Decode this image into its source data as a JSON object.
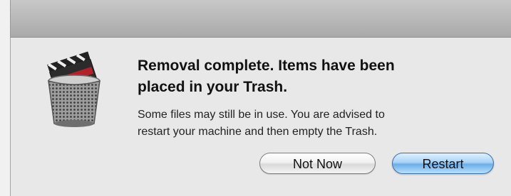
{
  "dialog": {
    "icon": "trash-with-clapperboard-icon",
    "title_line1": "Removal complete. Items have been",
    "title_line2": "placed in your Trash.",
    "message_line1": "Some files may still be in use. You are advised to",
    "message_line2": "restart your machine and then empty the Trash."
  },
  "buttons": {
    "not_now": "Not Now",
    "restart": "Restart"
  },
  "colors": {
    "default_button": "#6aaee8",
    "background": "#e8e8e8"
  }
}
